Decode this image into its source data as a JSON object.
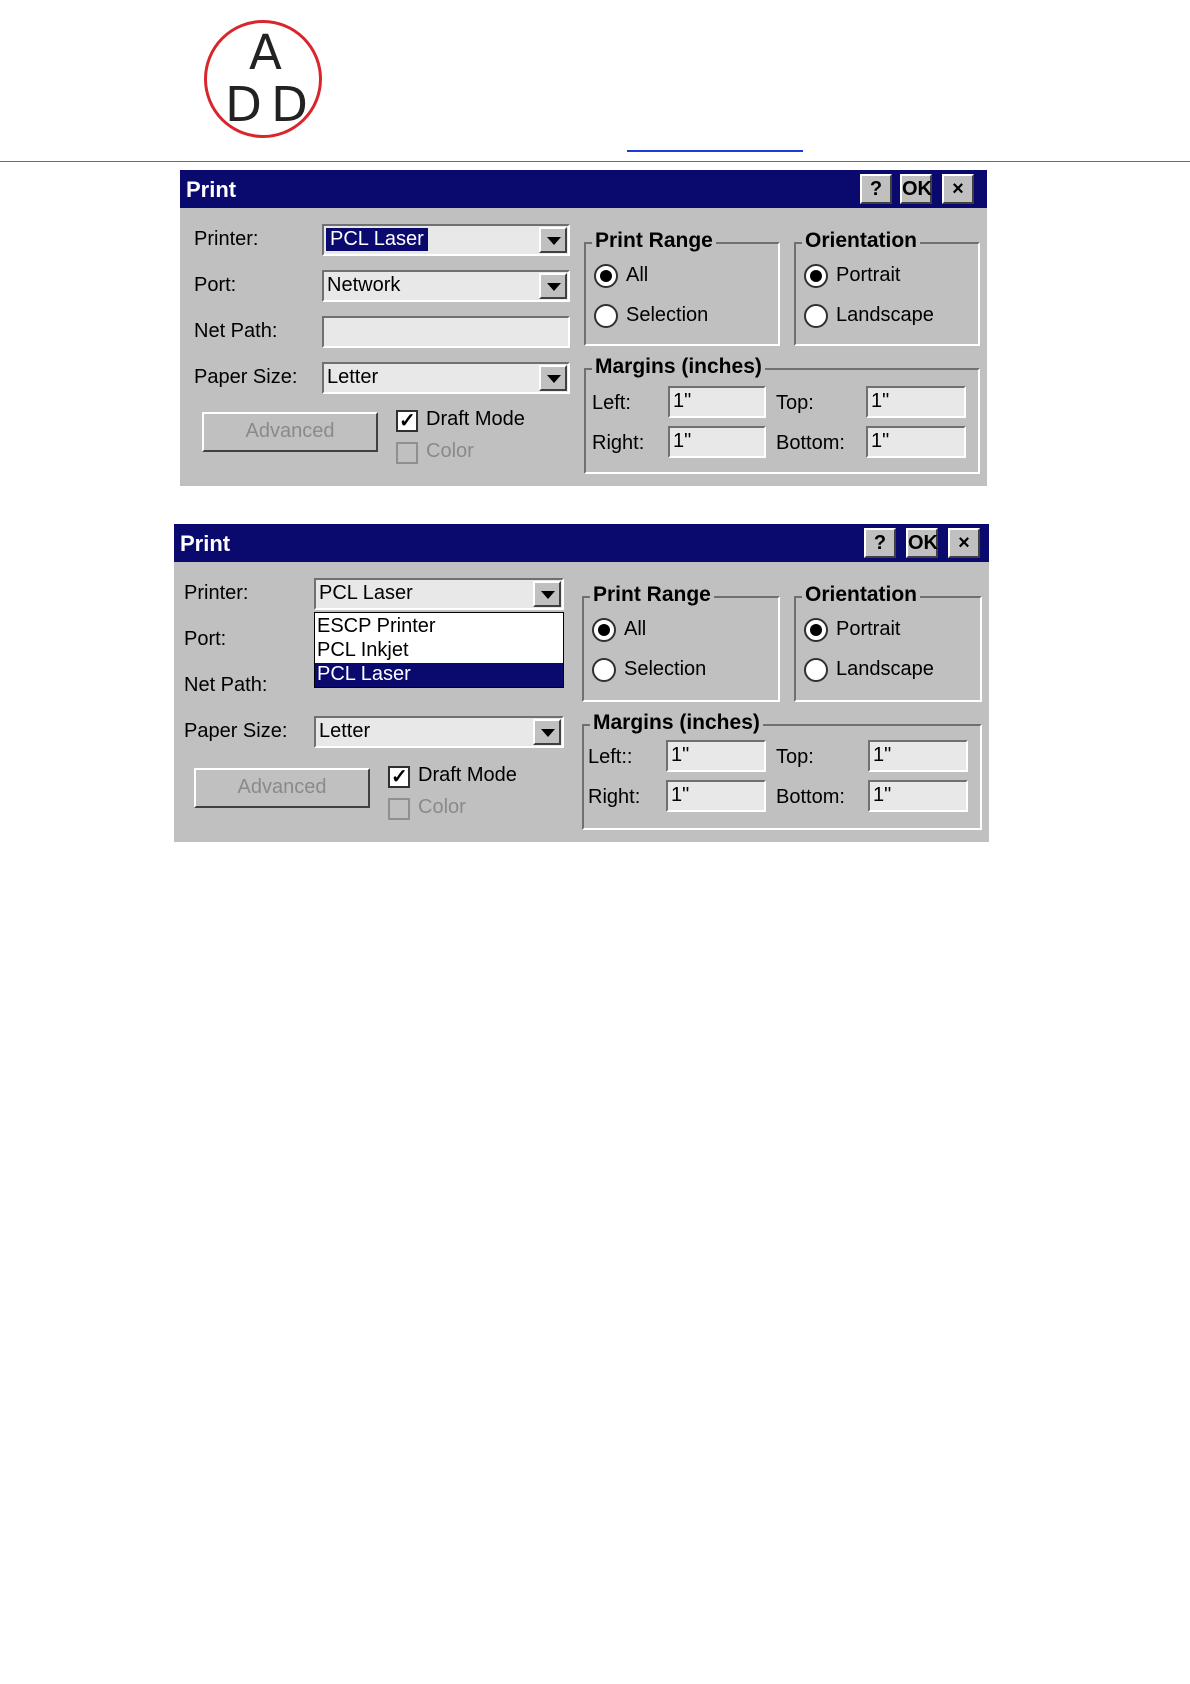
{
  "header": {
    "logo": "ADD"
  },
  "dialogs": [
    {
      "title": "Print",
      "buttons": {
        "help": "?",
        "ok": "OK",
        "close": "×"
      },
      "labels": {
        "printer": "Printer:",
        "port": "Port:",
        "net_path": "Net Path:",
        "paper_size": "Paper Size:"
      },
      "printer_value": "PCL Laser",
      "port_value": "Network",
      "net_path_value": "",
      "paper_size_value": "Letter",
      "advanced_label": "Advanced",
      "draft_mode_label": "Draft Mode",
      "draft_mode_checked": true,
      "color_label": "Color",
      "color_checked": false,
      "print_range": {
        "title": "Print Range",
        "all": "All",
        "selection": "Selection",
        "selected": "All"
      },
      "orientation": {
        "title": "Orientation",
        "portrait": "Portrait",
        "landscape": "Landscape",
        "selected": "Portrait"
      },
      "margins": {
        "title": "Margins (inches)",
        "left_label": "Left:",
        "right_label": "Right:",
        "top_label": "Top:",
        "bottom_label": "Bottom:",
        "left": "1\"",
        "right": "1\"",
        "top": "1\"",
        "bottom": "1\""
      }
    },
    {
      "title": "Print",
      "buttons": {
        "help": "?",
        "ok": "OK",
        "close": "×"
      },
      "labels": {
        "printer": "Printer:",
        "port": "Port:",
        "net_path": "Net Path:",
        "paper_size": "Paper Size:"
      },
      "printer_value": "PCL Laser",
      "printer_options": [
        "ESCP Printer",
        "PCL Inkjet",
        "PCL Laser"
      ],
      "printer_highlighted": "PCL Laser",
      "paper_size_value": "Letter",
      "advanced_label": "Advanced",
      "draft_mode_label": "Draft Mode",
      "draft_mode_checked": true,
      "color_label": "Color",
      "color_checked": false,
      "print_range": {
        "title": "Print Range",
        "all": "All",
        "selection": "Selection",
        "selected": "All"
      },
      "orientation": {
        "title": "Orientation",
        "portrait": "Portrait",
        "landscape": "Landscape",
        "selected": "Portrait"
      },
      "margins": {
        "title": "Margins (inches)",
        "left_label": "Left::",
        "right_label": "Right:",
        "top_label": "Top:",
        "bottom_label": "Bottom:",
        "left": "1\"",
        "right": "1\"",
        "top": "1\"",
        "bottom": "1\""
      }
    }
  ]
}
